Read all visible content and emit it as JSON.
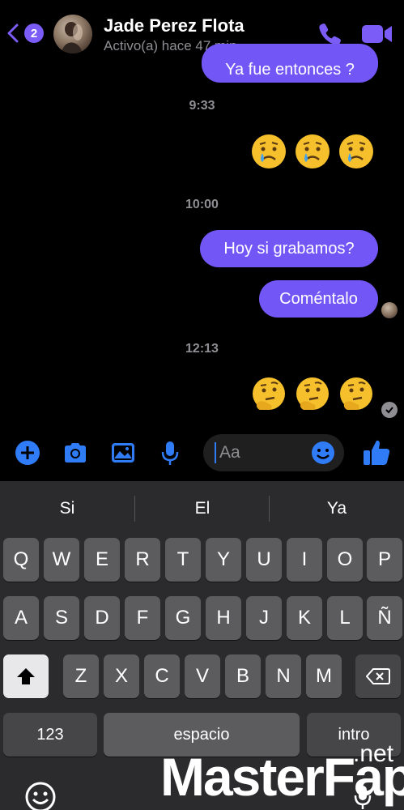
{
  "header": {
    "unread_count": "2",
    "contact_name": "Jade Perez Flota",
    "status": "Activo(a) hace 47 min",
    "icons": {
      "back": "chevron-left-icon",
      "call": "phone-icon",
      "video": "video-camera-icon"
    },
    "accent_color": "#7b5cf6"
  },
  "messages": [
    {
      "type": "text",
      "text": "Ya fue entonces ?"
    },
    {
      "type": "timestamp",
      "text": "9:33"
    },
    {
      "type": "emoji",
      "emojis": [
        "crying-face",
        "crying-face",
        "crying-face"
      ]
    },
    {
      "type": "timestamp",
      "text": "10:00"
    },
    {
      "type": "text",
      "text": "Hoy si grabamos?"
    },
    {
      "type": "text",
      "text": "Coméntalo"
    },
    {
      "type": "timestamp",
      "text": "12:13"
    },
    {
      "type": "emoji",
      "emojis": [
        "thinking-face",
        "thinking-face",
        "thinking-face"
      ]
    }
  ],
  "composer": {
    "placeholder": "Aa",
    "icons": [
      "plus-icon",
      "camera-icon",
      "gallery-icon",
      "microphone-icon",
      "emoji-icon",
      "like-icon"
    ]
  },
  "keyboard": {
    "suggestions": [
      "Si",
      "El",
      "Ya"
    ],
    "row1": [
      "Q",
      "W",
      "E",
      "R",
      "T",
      "Y",
      "U",
      "I",
      "O",
      "P"
    ],
    "row2": [
      "A",
      "S",
      "D",
      "F",
      "G",
      "H",
      "J",
      "K",
      "L",
      "Ñ"
    ],
    "row3": [
      "Z",
      "X",
      "C",
      "V",
      "B",
      "N",
      "M"
    ],
    "numbers_label": "123",
    "space_label": "espacio",
    "return_label": "intro"
  },
  "watermark": {
    "text": "MasterFap",
    "suffix": ".net"
  }
}
